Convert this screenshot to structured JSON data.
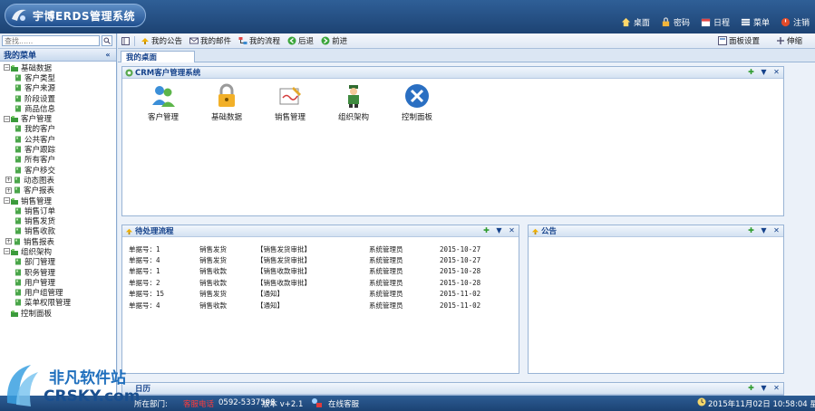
{
  "header": {
    "title": "宇博ERDS管理系统",
    "nav": [
      {
        "label": "桌面",
        "icon": "home-icon"
      },
      {
        "label": "密码",
        "icon": "lock-icon"
      },
      {
        "label": "日程",
        "icon": "calendar-icon"
      },
      {
        "label": "菜单",
        "icon": "menu-icon"
      },
      {
        "label": "注销",
        "icon": "logout-icon"
      }
    ]
  },
  "sidebar": {
    "search_placeholder": "查找......",
    "menu_title": "我的菜单",
    "tree": [
      {
        "label": "基础数据",
        "level": 0,
        "expanded": true
      },
      {
        "label": "客户类型",
        "level": 1
      },
      {
        "label": "客户来源",
        "level": 1
      },
      {
        "label": "阶段设置",
        "level": 1
      },
      {
        "label": "商品信息",
        "level": 1
      },
      {
        "label": "客户管理",
        "level": 0,
        "expanded": true
      },
      {
        "label": "我的客户",
        "level": 1
      },
      {
        "label": "公共客户",
        "level": 1
      },
      {
        "label": "客户跟踪",
        "level": 1
      },
      {
        "label": "所有客户",
        "level": 1
      },
      {
        "label": "客户移交",
        "level": 1
      },
      {
        "label": "动态图表",
        "level": 1,
        "expandable": true
      },
      {
        "label": "客户报表",
        "level": 1,
        "expandable": true
      },
      {
        "label": "销售管理",
        "level": 0,
        "expanded": true
      },
      {
        "label": "销售订单",
        "level": 1
      },
      {
        "label": "销售发货",
        "level": 1
      },
      {
        "label": "销售收款",
        "level": 1
      },
      {
        "label": "销售报表",
        "level": 1,
        "expandable": true
      },
      {
        "label": "组织架构",
        "level": 0,
        "expanded": true
      },
      {
        "label": "部门管理",
        "level": 1
      },
      {
        "label": "职务管理",
        "level": 1
      },
      {
        "label": "用户管理",
        "level": 1
      },
      {
        "label": "用户组管理",
        "level": 1
      },
      {
        "label": "菜单权限管理",
        "level": 1
      },
      {
        "label": "控制面板",
        "level": 0,
        "leaf": true
      }
    ]
  },
  "toolbar": {
    "items": [
      {
        "label": "我的公告",
        "icon": "notice-icon"
      },
      {
        "label": "我的邮件",
        "icon": "mail-icon"
      },
      {
        "label": "我的流程",
        "icon": "flow-icon"
      },
      {
        "label": "后退",
        "icon": "back-icon"
      },
      {
        "label": "前进",
        "icon": "forward-icon"
      }
    ],
    "right": [
      {
        "label": "面板设置",
        "icon": "panel-settings-icon"
      },
      {
        "label": "伸缩",
        "icon": "toggle-icon"
      }
    ]
  },
  "tabs": [
    {
      "label": "我的桌面"
    }
  ],
  "crm_panel": {
    "title": "CRM客户管理系统",
    "apps": [
      {
        "label": "客户管理",
        "icon": "users-icon"
      },
      {
        "label": "基础数据",
        "icon": "padlock-icon"
      },
      {
        "label": "销售管理",
        "icon": "contract-icon"
      },
      {
        "label": "组织架构",
        "icon": "person-icon"
      },
      {
        "label": "控制面板",
        "icon": "tools-icon"
      }
    ]
  },
  "workflow_panel": {
    "title": "待处理流程",
    "rows": [
      {
        "no": "单据号：1",
        "type": "销售发货",
        "action": "【销售发货审批】",
        "user": "系统管理员",
        "date": "2015-10-27"
      },
      {
        "no": "单据号：4",
        "type": "销售发货",
        "action": "【销售发货审批】",
        "user": "系统管理员",
        "date": "2015-10-27"
      },
      {
        "no": "单据号：1",
        "type": "销售收款",
        "action": "【销售收款审批】",
        "user": "系统管理员",
        "date": "2015-10-28"
      },
      {
        "no": "单据号：2",
        "type": "销售收款",
        "action": "【销售收款审批】",
        "user": "系统管理员",
        "date": "2015-10-28"
      },
      {
        "no": "单据号：15",
        "type": "销售发货",
        "action": "【通知】",
        "user": "系统管理员",
        "date": "2015-11-02"
      },
      {
        "no": "单据号：4",
        "type": "销售收款",
        "action": "【通知】",
        "user": "系统管理员",
        "date": "2015-11-02"
      }
    ]
  },
  "notice_panel": {
    "title": "公告"
  },
  "bottom_panel": {
    "title": "日历"
  },
  "statusbar": {
    "dept_label": "所在部门:",
    "hotline": "客服电话",
    "phone": "0592-5337598",
    "version": "版本 v+2.1",
    "online": "在线客服",
    "datetime": "2015年11月02日  10:58:04 星期一"
  },
  "watermark": {
    "line1": "非凡软件站",
    "line2": "CRSKY.com"
  }
}
